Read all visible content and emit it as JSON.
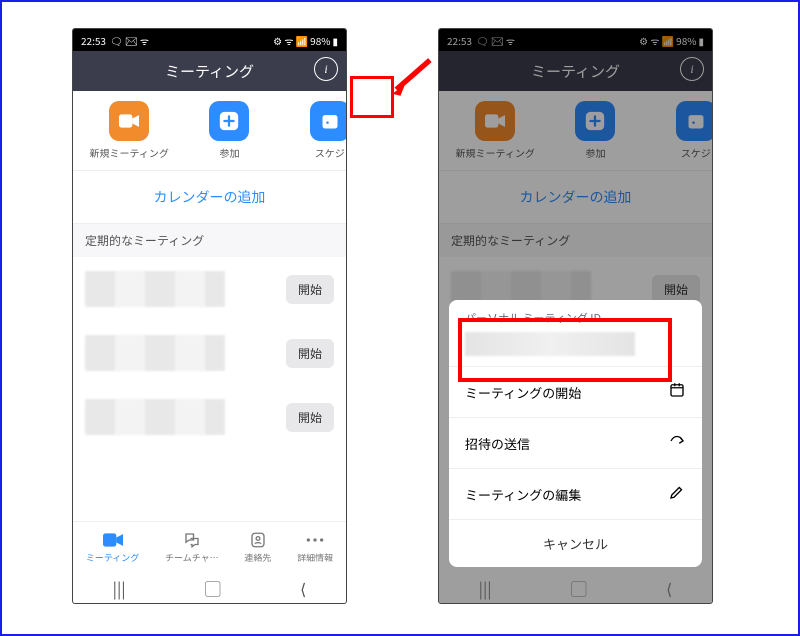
{
  "status": {
    "time": "22:53",
    "battery": "98%"
  },
  "header": {
    "title": "ミーティング"
  },
  "actions": {
    "newMeeting": "新規ミーティング",
    "join": "参加",
    "schedule": "スケジ"
  },
  "addCalendar": "カレンダーの追加",
  "recurringLabel": "定期的なミーティング",
  "startBtn": "開始",
  "nav": {
    "meeting": "ミーティング",
    "teamChat": "チームチャ…",
    "contacts": "連絡先",
    "more": "詳細情報"
  },
  "sheet": {
    "pmiLabel": "パーソナル ミーティング ID",
    "startMeeting": "ミーティングの開始",
    "sendInvite": "招待の送信",
    "editMeeting": "ミーティングの編集",
    "cancel": "キャンセル"
  }
}
